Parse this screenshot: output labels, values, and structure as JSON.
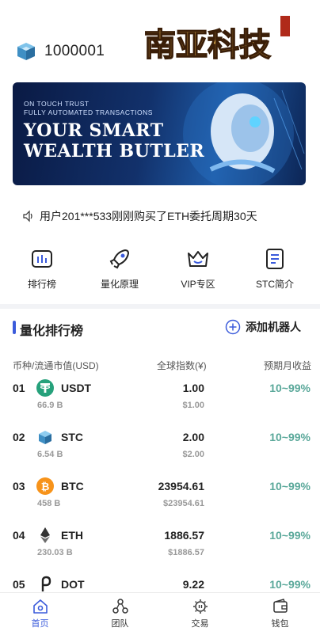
{
  "header": {
    "account_id": "1000001",
    "logo_text": "南亚科技"
  },
  "banner": {
    "line1": "ON  TOUCH  TRUST",
    "line2": "FULLY AUTOMATED TRANSACTIONS",
    "headline1": "YOUR SMART",
    "headline2": "WEALTH BUTLER"
  },
  "notice": {
    "text": "用户201***533刚刚购买了ETH委托周期30天",
    "icon": "speaker-icon"
  },
  "quick_links": [
    {
      "label": "排行榜",
      "icon": "chart-icon"
    },
    {
      "label": "量化原理",
      "icon": "rocket-icon"
    },
    {
      "label": "VIP专区",
      "icon": "crown-icon"
    },
    {
      "label": "STC简介",
      "icon": "document-icon"
    }
  ],
  "section": {
    "title": "量化排行榜",
    "add_label": "添加机器人"
  },
  "columns": {
    "coin": "币种/流通市值(USD)",
    "index": "全球指数(¥)",
    "yield": "预期月收益"
  },
  "rows": [
    {
      "rank": "01",
      "name": "USDT",
      "cap": "66.9 B",
      "price": "1.00",
      "price_usd": "$1.00",
      "yield": "10~99%",
      "icon": "tether-icon",
      "color": "#26a17b"
    },
    {
      "rank": "02",
      "name": "STC",
      "cap": "6.54 B",
      "price": "2.00",
      "price_usd": "$2.00",
      "yield": "10~99%",
      "icon": "cube-icon",
      "color": "#4aa3d8"
    },
    {
      "rank": "03",
      "name": "BTC",
      "cap": "458 B",
      "price": "23954.61",
      "price_usd": "$23954.61",
      "yield": "10~99%",
      "icon": "bitcoin-icon",
      "color": "#f7931a"
    },
    {
      "rank": "04",
      "name": "ETH",
      "cap": "230.03 B",
      "price": "1886.57",
      "price_usd": "$1886.57",
      "yield": "10~99%",
      "icon": "ethereum-icon",
      "color": "#343434"
    },
    {
      "rank": "05",
      "name": "DOT",
      "cap": "",
      "price": "9.22",
      "price_usd": "",
      "yield": "10~99%",
      "icon": "polkadot-icon",
      "color": "#222222"
    }
  ],
  "tabs": [
    {
      "label": "首页",
      "icon": "home-icon",
      "active": true
    },
    {
      "label": "团队",
      "icon": "team-icon",
      "active": false
    },
    {
      "label": "交易",
      "icon": "trade-icon",
      "active": false
    },
    {
      "label": "钱包",
      "icon": "wallet-icon",
      "active": false
    }
  ],
  "colors": {
    "accent": "#3b5bdb",
    "yield": "#5aa89a"
  }
}
